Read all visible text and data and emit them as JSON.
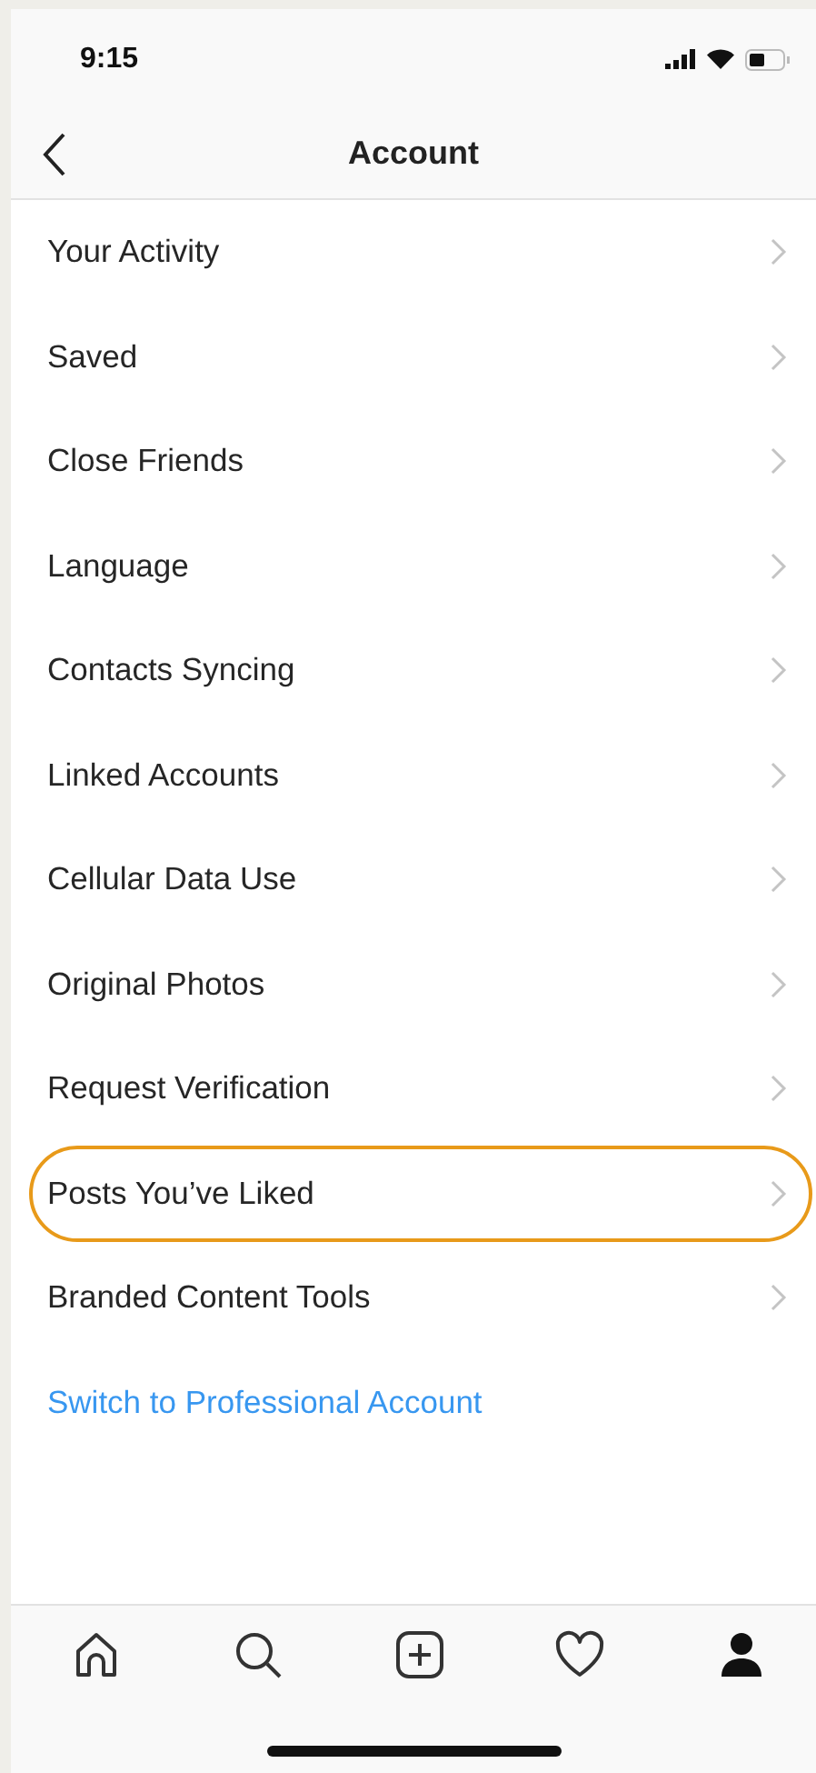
{
  "status_bar": {
    "time": "9:15"
  },
  "nav": {
    "title": "Account"
  },
  "items": [
    {
      "label": "Your Activity",
      "highlighted": false
    },
    {
      "label": "Saved",
      "highlighted": false
    },
    {
      "label": "Close Friends",
      "highlighted": false
    },
    {
      "label": "Language",
      "highlighted": false
    },
    {
      "label": "Contacts Syncing",
      "highlighted": false
    },
    {
      "label": "Linked Accounts",
      "highlighted": false
    },
    {
      "label": "Cellular Data Use",
      "highlighted": false
    },
    {
      "label": "Original Photos",
      "highlighted": false
    },
    {
      "label": "Request Verification",
      "highlighted": false
    },
    {
      "label": "Posts You’ve Liked",
      "highlighted": true
    },
    {
      "label": "Branded Content Tools",
      "highlighted": false
    }
  ],
  "link": "Switch to Professional Account",
  "tab_bar": [
    {
      "kind": "home",
      "selected": false
    },
    {
      "kind": "search",
      "selected": false
    },
    {
      "kind": "add",
      "selected": false
    },
    {
      "kind": "activity",
      "selected": false
    },
    {
      "kind": "profile",
      "selected": true
    }
  ]
}
